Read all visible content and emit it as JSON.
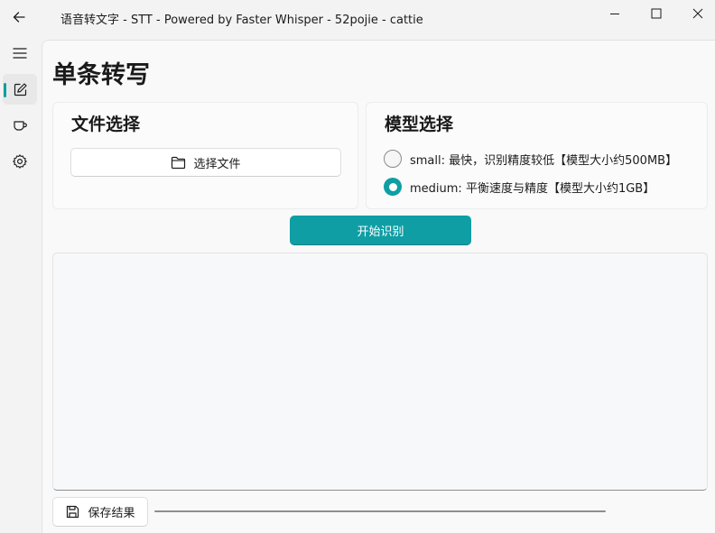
{
  "window": {
    "title": "语音转文字 - STT - Powered by Faster Whisper - 52pojie - cattie"
  },
  "sidebar": {
    "items": [
      {
        "icon": "menu-icon"
      },
      {
        "icon": "edit-icon",
        "active": true
      },
      {
        "icon": "cup-icon"
      },
      {
        "icon": "gear-icon"
      }
    ]
  },
  "page": {
    "title": "单条转写"
  },
  "file_card": {
    "title": "文件选择",
    "select_button_label": "选择文件"
  },
  "model_card": {
    "title": "模型选择",
    "options": [
      {
        "label": "small: 最快，识别精度较低【模型大小约500MB】",
        "selected": false
      },
      {
        "label": "medium: 平衡速度与精度【模型大小约1GB】",
        "selected": true
      }
    ]
  },
  "actions": {
    "start_label": "开始识别",
    "save_label": "保存结果"
  },
  "result": {
    "text": ""
  },
  "progress": {
    "value": 0
  },
  "colors": {
    "accent": "#0f9ea4"
  }
}
